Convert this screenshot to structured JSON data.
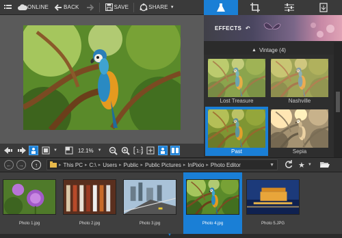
{
  "toolbar": {
    "menu_icon": "menu-icon",
    "online_label": "ONLINE",
    "back_label": "BACK",
    "save_label": "SAVE",
    "share_label": "SHARE"
  },
  "right_tabs": [
    "effects-flask-icon",
    "crop-icon",
    "adjust-sliders-icon",
    "export-icon"
  ],
  "effects": {
    "title": "EFFECTS",
    "group_label": "Vintage (4)",
    "items": [
      {
        "label": "Lost Treasure",
        "selected": false
      },
      {
        "label": "Nashville",
        "selected": false
      },
      {
        "label": "Past",
        "selected": true
      },
      {
        "label": "Sepia",
        "selected": false
      }
    ]
  },
  "zoom": {
    "value": "12.1%"
  },
  "breadcrumb": {
    "items": [
      "This PC",
      "C:\\",
      "Users",
      "Public",
      "Public Pictures",
      "InPixio",
      "Photo Editor"
    ]
  },
  "filmstrip": {
    "items": [
      {
        "label": "Photo 1.jpg",
        "selected": false
      },
      {
        "label": "Photo 2.jpg",
        "selected": false
      },
      {
        "label": "Photo 3.jpg",
        "selected": false
      },
      {
        "label": "Photo 4.jpg",
        "selected": true
      },
      {
        "label": "Photo 5.JPG",
        "selected": false
      }
    ]
  },
  "colors": {
    "accent": "#1a7fd6",
    "toolbar": "#3a3a3a",
    "canvas": "#5a5a5a"
  }
}
